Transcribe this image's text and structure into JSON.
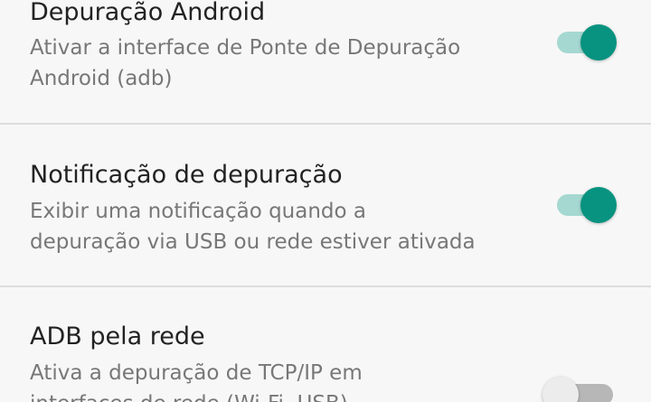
{
  "settings": [
    {
      "title": "Depuração Android",
      "summary_lines": [
        "Ativar a interface de Ponte de Depuração",
        "Android (adb)"
      ],
      "enabled": true
    },
    {
      "title": "Notificação de depuração",
      "summary_lines": [
        "Exibir uma notificação quando a",
        "depuração via USB ou rede estiver ativada"
      ],
      "enabled": true
    },
    {
      "title": "ADB pela rede",
      "summary_lines": [
        "Ativa a depuração de TCP/IP em",
        "interfaces de rede (Wi-Fi, USB)"
      ],
      "enabled": false
    }
  ],
  "colors": {
    "switch_on_thumb": "#079380",
    "switch_on_track": "#a5d8d1",
    "switch_off_thumb": "#ececec",
    "switch_off_track": "#b7b7b7",
    "background": "#f7f7f7",
    "title_text": "#222222",
    "summary_text": "#777777",
    "divider": "#dddddd"
  }
}
